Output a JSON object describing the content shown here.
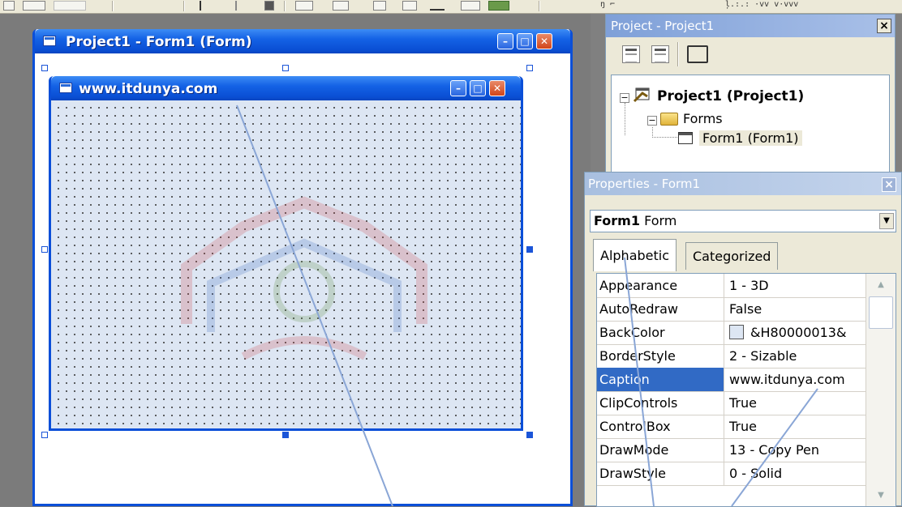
{
  "colors": {
    "xp_title_blue": "#0a4fd4",
    "form_grid_bg": "#dde6f3",
    "selection_blue": "#316ac5",
    "callout_line": "#8aa6d6"
  },
  "toolbar": {
    "text_a": "ŋ ⌐",
    "text_b": "ļ.:.: ·vv v·vvv"
  },
  "outer_window": {
    "title": "Project1 - Form1 (Form)",
    "icon": "form-icon",
    "buttons": {
      "minimize": "minimize-icon",
      "maximize": "maximize-icon",
      "close": "close-icon"
    }
  },
  "inner_form": {
    "title": "www.itdunya.com",
    "icon": "form-icon"
  },
  "watermark_icon": "itdunya-logo-watermark",
  "project_panel": {
    "title": "Project - Project1",
    "close": "×",
    "toolbar": [
      "view-code-icon",
      "view-object-icon",
      "toggle-folders-icon"
    ],
    "tree": {
      "root": "Project1 (Project1)",
      "folder": "Forms",
      "item": "Form1 (Form1)"
    }
  },
  "properties_panel": {
    "title": "Properties - Form1",
    "close": "×",
    "object_name": "Form1",
    "object_type": "Form",
    "tabs": [
      "Alphabetic",
      "Categorized"
    ],
    "active_tab": "Alphabetic",
    "rows": [
      {
        "name": "Appearance",
        "value": "1 - 3D"
      },
      {
        "name": "AutoRedraw",
        "value": "False"
      },
      {
        "name": "BackColor",
        "value": "&H80000013&"
      },
      {
        "name": "BorderStyle",
        "value": "2 - Sizable"
      },
      {
        "name": "Caption",
        "value": "www.itdunya.com",
        "selected": true
      },
      {
        "name": "ClipControls",
        "value": "True"
      },
      {
        "name": "ControlBox",
        "value": "True"
      },
      {
        "name": "DrawMode",
        "value": "13 - Copy Pen"
      },
      {
        "name": "DrawStyle",
        "value": "0 - Solid"
      }
    ]
  }
}
